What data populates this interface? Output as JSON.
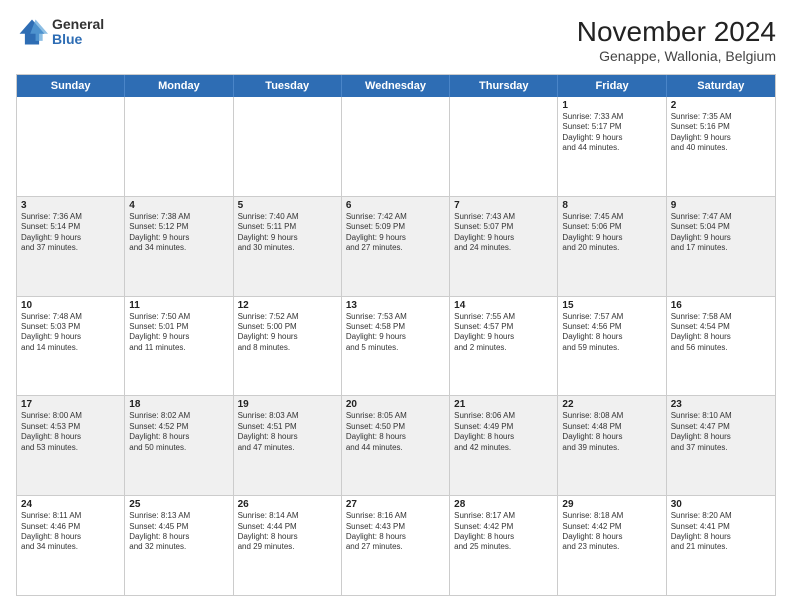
{
  "logo": {
    "general": "General",
    "blue": "Blue"
  },
  "header": {
    "title": "November 2024",
    "subtitle": "Genappe, Wallonia, Belgium"
  },
  "weekdays": [
    "Sunday",
    "Monday",
    "Tuesday",
    "Wednesday",
    "Thursday",
    "Friday",
    "Saturday"
  ],
  "rows": [
    {
      "alt": false,
      "cells": [
        {
          "day": "",
          "info": ""
        },
        {
          "day": "",
          "info": ""
        },
        {
          "day": "",
          "info": ""
        },
        {
          "day": "",
          "info": ""
        },
        {
          "day": "",
          "info": ""
        },
        {
          "day": "1",
          "info": "Sunrise: 7:33 AM\nSunset: 5:17 PM\nDaylight: 9 hours\nand 44 minutes."
        },
        {
          "day": "2",
          "info": "Sunrise: 7:35 AM\nSunset: 5:16 PM\nDaylight: 9 hours\nand 40 minutes."
        }
      ]
    },
    {
      "alt": true,
      "cells": [
        {
          "day": "3",
          "info": "Sunrise: 7:36 AM\nSunset: 5:14 PM\nDaylight: 9 hours\nand 37 minutes."
        },
        {
          "day": "4",
          "info": "Sunrise: 7:38 AM\nSunset: 5:12 PM\nDaylight: 9 hours\nand 34 minutes."
        },
        {
          "day": "5",
          "info": "Sunrise: 7:40 AM\nSunset: 5:11 PM\nDaylight: 9 hours\nand 30 minutes."
        },
        {
          "day": "6",
          "info": "Sunrise: 7:42 AM\nSunset: 5:09 PM\nDaylight: 9 hours\nand 27 minutes."
        },
        {
          "day": "7",
          "info": "Sunrise: 7:43 AM\nSunset: 5:07 PM\nDaylight: 9 hours\nand 24 minutes."
        },
        {
          "day": "8",
          "info": "Sunrise: 7:45 AM\nSunset: 5:06 PM\nDaylight: 9 hours\nand 20 minutes."
        },
        {
          "day": "9",
          "info": "Sunrise: 7:47 AM\nSunset: 5:04 PM\nDaylight: 9 hours\nand 17 minutes."
        }
      ]
    },
    {
      "alt": false,
      "cells": [
        {
          "day": "10",
          "info": "Sunrise: 7:48 AM\nSunset: 5:03 PM\nDaylight: 9 hours\nand 14 minutes."
        },
        {
          "day": "11",
          "info": "Sunrise: 7:50 AM\nSunset: 5:01 PM\nDaylight: 9 hours\nand 11 minutes."
        },
        {
          "day": "12",
          "info": "Sunrise: 7:52 AM\nSunset: 5:00 PM\nDaylight: 9 hours\nand 8 minutes."
        },
        {
          "day": "13",
          "info": "Sunrise: 7:53 AM\nSunset: 4:58 PM\nDaylight: 9 hours\nand 5 minutes."
        },
        {
          "day": "14",
          "info": "Sunrise: 7:55 AM\nSunset: 4:57 PM\nDaylight: 9 hours\nand 2 minutes."
        },
        {
          "day": "15",
          "info": "Sunrise: 7:57 AM\nSunset: 4:56 PM\nDaylight: 8 hours\nand 59 minutes."
        },
        {
          "day": "16",
          "info": "Sunrise: 7:58 AM\nSunset: 4:54 PM\nDaylight: 8 hours\nand 56 minutes."
        }
      ]
    },
    {
      "alt": true,
      "cells": [
        {
          "day": "17",
          "info": "Sunrise: 8:00 AM\nSunset: 4:53 PM\nDaylight: 8 hours\nand 53 minutes."
        },
        {
          "day": "18",
          "info": "Sunrise: 8:02 AM\nSunset: 4:52 PM\nDaylight: 8 hours\nand 50 minutes."
        },
        {
          "day": "19",
          "info": "Sunrise: 8:03 AM\nSunset: 4:51 PM\nDaylight: 8 hours\nand 47 minutes."
        },
        {
          "day": "20",
          "info": "Sunrise: 8:05 AM\nSunset: 4:50 PM\nDaylight: 8 hours\nand 44 minutes."
        },
        {
          "day": "21",
          "info": "Sunrise: 8:06 AM\nSunset: 4:49 PM\nDaylight: 8 hours\nand 42 minutes."
        },
        {
          "day": "22",
          "info": "Sunrise: 8:08 AM\nSunset: 4:48 PM\nDaylight: 8 hours\nand 39 minutes."
        },
        {
          "day": "23",
          "info": "Sunrise: 8:10 AM\nSunset: 4:47 PM\nDaylight: 8 hours\nand 37 minutes."
        }
      ]
    },
    {
      "alt": false,
      "cells": [
        {
          "day": "24",
          "info": "Sunrise: 8:11 AM\nSunset: 4:46 PM\nDaylight: 8 hours\nand 34 minutes."
        },
        {
          "day": "25",
          "info": "Sunrise: 8:13 AM\nSunset: 4:45 PM\nDaylight: 8 hours\nand 32 minutes."
        },
        {
          "day": "26",
          "info": "Sunrise: 8:14 AM\nSunset: 4:44 PM\nDaylight: 8 hours\nand 29 minutes."
        },
        {
          "day": "27",
          "info": "Sunrise: 8:16 AM\nSunset: 4:43 PM\nDaylight: 8 hours\nand 27 minutes."
        },
        {
          "day": "28",
          "info": "Sunrise: 8:17 AM\nSunset: 4:42 PM\nDaylight: 8 hours\nand 25 minutes."
        },
        {
          "day": "29",
          "info": "Sunrise: 8:18 AM\nSunset: 4:42 PM\nDaylight: 8 hours\nand 23 minutes."
        },
        {
          "day": "30",
          "info": "Sunrise: 8:20 AM\nSunset: 4:41 PM\nDaylight: 8 hours\nand 21 minutes."
        }
      ]
    }
  ]
}
